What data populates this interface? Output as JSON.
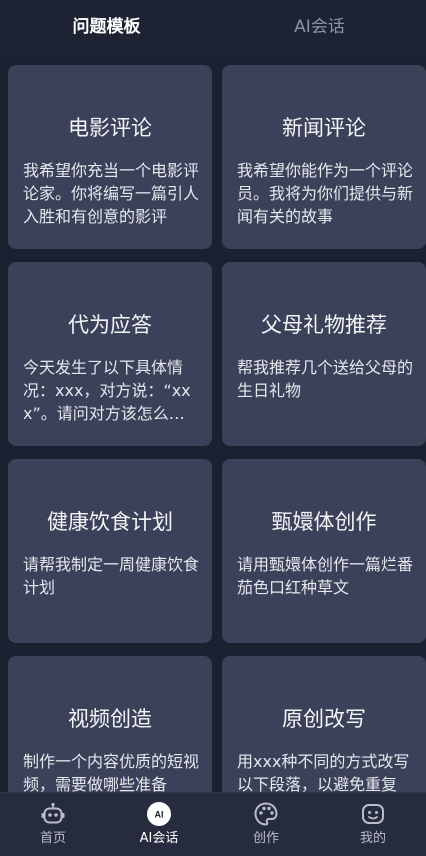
{
  "header": {
    "tabs": [
      {
        "label": "问题模板"
      },
      {
        "label": "AI会话"
      }
    ]
  },
  "cards": [
    {
      "title": "电影评论",
      "desc": "我希望你充当一个电影评论家。你将编写一篇引人入胜和有创意的影评"
    },
    {
      "title": "新闻评论",
      "desc": "我希望你能作为一个评论员。我将为你们提供与新闻有关的故事"
    },
    {
      "title": "代为应答",
      "desc": "今天发生了以下具体情况：xxx，对方说：“xxx”。请问对方该怎么回答"
    },
    {
      "title": "父母礼物推荐",
      "desc": "帮我推荐几个送给父母的生日礼物"
    },
    {
      "title": "健康饮食计划",
      "desc": "请帮我制定一周健康饮食计划"
    },
    {
      "title": "甄嬛体创作",
      "desc": "请用甄嬛体创作一篇烂番茄色口红种草文"
    },
    {
      "title": "视频创造",
      "desc": "制作一个内容优质的短视频，需要做哪些准备"
    },
    {
      "title": "原创改写",
      "desc": "用xxx种不同的方式改写以下段落，以避免重复"
    }
  ],
  "bottom_nav": {
    "items": [
      {
        "label": "首页",
        "icon": "robot-icon"
      },
      {
        "label": "AI会话",
        "icon": "ai-chat-icon",
        "badge": "AI"
      },
      {
        "label": "创作",
        "icon": "palette-icon"
      },
      {
        "label": "我的",
        "icon": "profile-icon"
      }
    ]
  }
}
